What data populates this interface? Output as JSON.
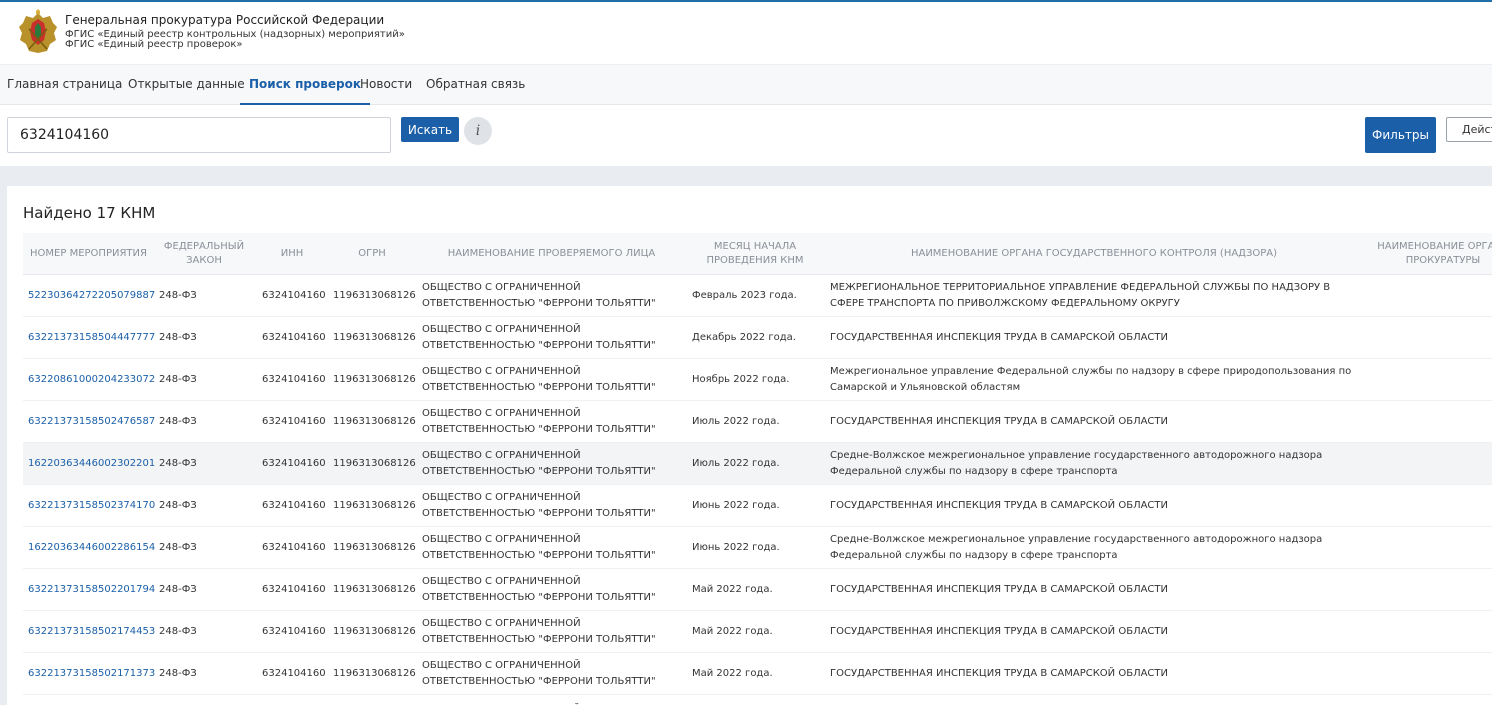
{
  "header": {
    "org_title": "Генеральная прокуратура Российской Федерации",
    "subtitle1": "ФГИС «Единый реестр контрольных (надзорных) мероприятий»",
    "subtitle2": "ФГИС «Единый реестр проверок»"
  },
  "nav": {
    "items": [
      {
        "label": "Главная страница"
      },
      {
        "label": "Открытые данные"
      },
      {
        "label": "Поиск проверок"
      },
      {
        "label": "Новости"
      },
      {
        "label": "Обратная связь"
      }
    ],
    "active": "Поиск проверок"
  },
  "search": {
    "value": "6324104160",
    "button": "Искать",
    "info": "i",
    "filters": "Фильтры",
    "actions": "Действия"
  },
  "results": {
    "found_label": "Найдено 17 КНМ",
    "columns": [
      "Номер мероприятия",
      "Федеральный закон",
      "ИНН",
      "ОГРН",
      "Наименование проверяемого лица",
      "Месяц начала проведения КНМ",
      "Наименование органа государственного контроля (надзора)",
      "Наименование органа прокуратуры"
    ],
    "rows": [
      {
        "num": "52230364272205079887",
        "law": "248-ФЗ",
        "inn": "6324104160",
        "ogrn": "1196313068126",
        "name": "ОБЩЕСТВО С ОГРАНИЧЕННОЙ ОТВЕТСТВЕННОСТЬЮ \"ФЕРРОНИ ТОЛЬЯТТИ\"",
        "month": "Февраль 2023 года.",
        "org": "МЕЖРЕГИОНАЛЬНОЕ ТЕРРИТОРИАЛЬНОЕ УПРАВЛЕНИЕ ФЕДЕРАЛЬНОЙ СЛУЖБЫ ПО НАДЗОРУ В СФЕРЕ ТРАНСПОРТА ПО ПРИВОЛЖСКОМУ ФЕДЕРАЛЬНОМУ ОКРУГУ"
      },
      {
        "num": "63221373158504447777",
        "law": "248-ФЗ",
        "inn": "6324104160",
        "ogrn": "1196313068126",
        "name": "ОБЩЕСТВО С ОГРАНИЧЕННОЙ ОТВЕТСТВЕННОСТЬЮ \"ФЕРРОНИ ТОЛЬЯТТИ\"",
        "month": "Декабрь 2022 года.",
        "org": "ГОСУДАРСТВЕННАЯ ИНСПЕКЦИЯ ТРУДА В САМАРСКОЙ ОБЛАСТИ"
      },
      {
        "num": "63220861000204233072",
        "law": "248-ФЗ",
        "inn": "6324104160",
        "ogrn": "1196313068126",
        "name": "ОБЩЕСТВО С ОГРАНИЧЕННОЙ ОТВЕТСТВЕННОСТЬЮ \"ФЕРРОНИ ТОЛЬЯТТИ\"",
        "month": "Ноябрь 2022 года.",
        "org": "Межрегиональное управление Федеральной службы по надзору в сфере природопользования по Самарской и Ульяновской областям"
      },
      {
        "num": "63221373158502476587",
        "law": "248-ФЗ",
        "inn": "6324104160",
        "ogrn": "1196313068126",
        "name": "ОБЩЕСТВО С ОГРАНИЧЕННОЙ ОТВЕТСТВЕННОСТЬЮ \"ФЕРРОНИ ТОЛЬЯТТИ\"",
        "month": "Июль 2022 года.",
        "org": "ГОСУДАРСТВЕННАЯ ИНСПЕКЦИЯ ТРУДА В САМАРСКОЙ ОБЛАСТИ"
      },
      {
        "num": "16220363446002302201",
        "law": "248-ФЗ",
        "inn": "6324104160",
        "ogrn": "1196313068126",
        "name": "ОБЩЕСТВО С ОГРАНИЧЕННОЙ ОТВЕТСТВЕННОСТЬЮ \"ФЕРРОНИ ТОЛЬЯТТИ\"",
        "month": "Июль 2022 года.",
        "org": "Средне-Волжское межрегиональное управление государственного автодорожного надзора Федеральной службы по надзору в сфере транспорта"
      },
      {
        "num": "63221373158502374170",
        "law": "248-ФЗ",
        "inn": "6324104160",
        "ogrn": "1196313068126",
        "name": "ОБЩЕСТВО С ОГРАНИЧЕННОЙ ОТВЕТСТВЕННОСТЬЮ \"ФЕРРОНИ ТОЛЬЯТТИ\"",
        "month": "Июнь 2022 года.",
        "org": "ГОСУДАРСТВЕННАЯ ИНСПЕКЦИЯ ТРУДА В САМАРСКОЙ ОБЛАСТИ"
      },
      {
        "num": "16220363446002286154",
        "law": "248-ФЗ",
        "inn": "6324104160",
        "ogrn": "1196313068126",
        "name": "ОБЩЕСТВО С ОГРАНИЧЕННОЙ ОТВЕТСТВЕННОСТЬЮ \"ФЕРРОНИ ТОЛЬЯТТИ\"",
        "month": "Июнь 2022 года.",
        "org": "Средне-Волжское межрегиональное управление государственного автодорожного надзора Федеральной службы по надзору в сфере транспорта"
      },
      {
        "num": "63221373158502201794",
        "law": "248-ФЗ",
        "inn": "6324104160",
        "ogrn": "1196313068126",
        "name": "ОБЩЕСТВО С ОГРАНИЧЕННОЙ ОТВЕТСТВЕННОСТЬЮ \"ФЕРРОНИ ТОЛЬЯТТИ\"",
        "month": "Май 2022 года.",
        "org": "ГОСУДАРСТВЕННАЯ ИНСПЕКЦИЯ ТРУДА В САМАРСКОЙ ОБЛАСТИ"
      },
      {
        "num": "63221373158502174453",
        "law": "248-ФЗ",
        "inn": "6324104160",
        "ogrn": "1196313068126",
        "name": "ОБЩЕСТВО С ОГРАНИЧЕННОЙ ОТВЕТСТВЕННОСТЬЮ \"ФЕРРОНИ ТОЛЬЯТТИ\"",
        "month": "Май 2022 года.",
        "org": "ГОСУДАРСТВЕННАЯ ИНСПЕКЦИЯ ТРУДА В САМАРСКОЙ ОБЛАСТИ"
      },
      {
        "num": "63221373158502171373",
        "law": "248-ФЗ",
        "inn": "6324104160",
        "ogrn": "1196313068126",
        "name": "ОБЩЕСТВО С ОГРАНИЧЕННОЙ ОТВЕТСТВЕННОСТЬЮ \"ФЕРРОНИ ТОЛЬЯТТИ\"",
        "month": "Май 2022 года.",
        "org": "ГОСУДАРСТВЕННАЯ ИНСПЕКЦИЯ ТРУДА В САМАРСКОЙ ОБЛАСТИ"
      },
      {
        "num": "",
        "law": "",
        "inn": "",
        "ogrn": "",
        "name": "ОБЩЕСТВО С ОГРАНИЧЕННОЙ ОТВЕТСТВЕННОСТЬЮ",
        "month": "",
        "org": ""
      }
    ]
  },
  "colors": {
    "accent": "#1b5fa8",
    "topline": "#1f6fa8",
    "band": "#e9ecf0",
    "header_text": "#8a9098"
  }
}
